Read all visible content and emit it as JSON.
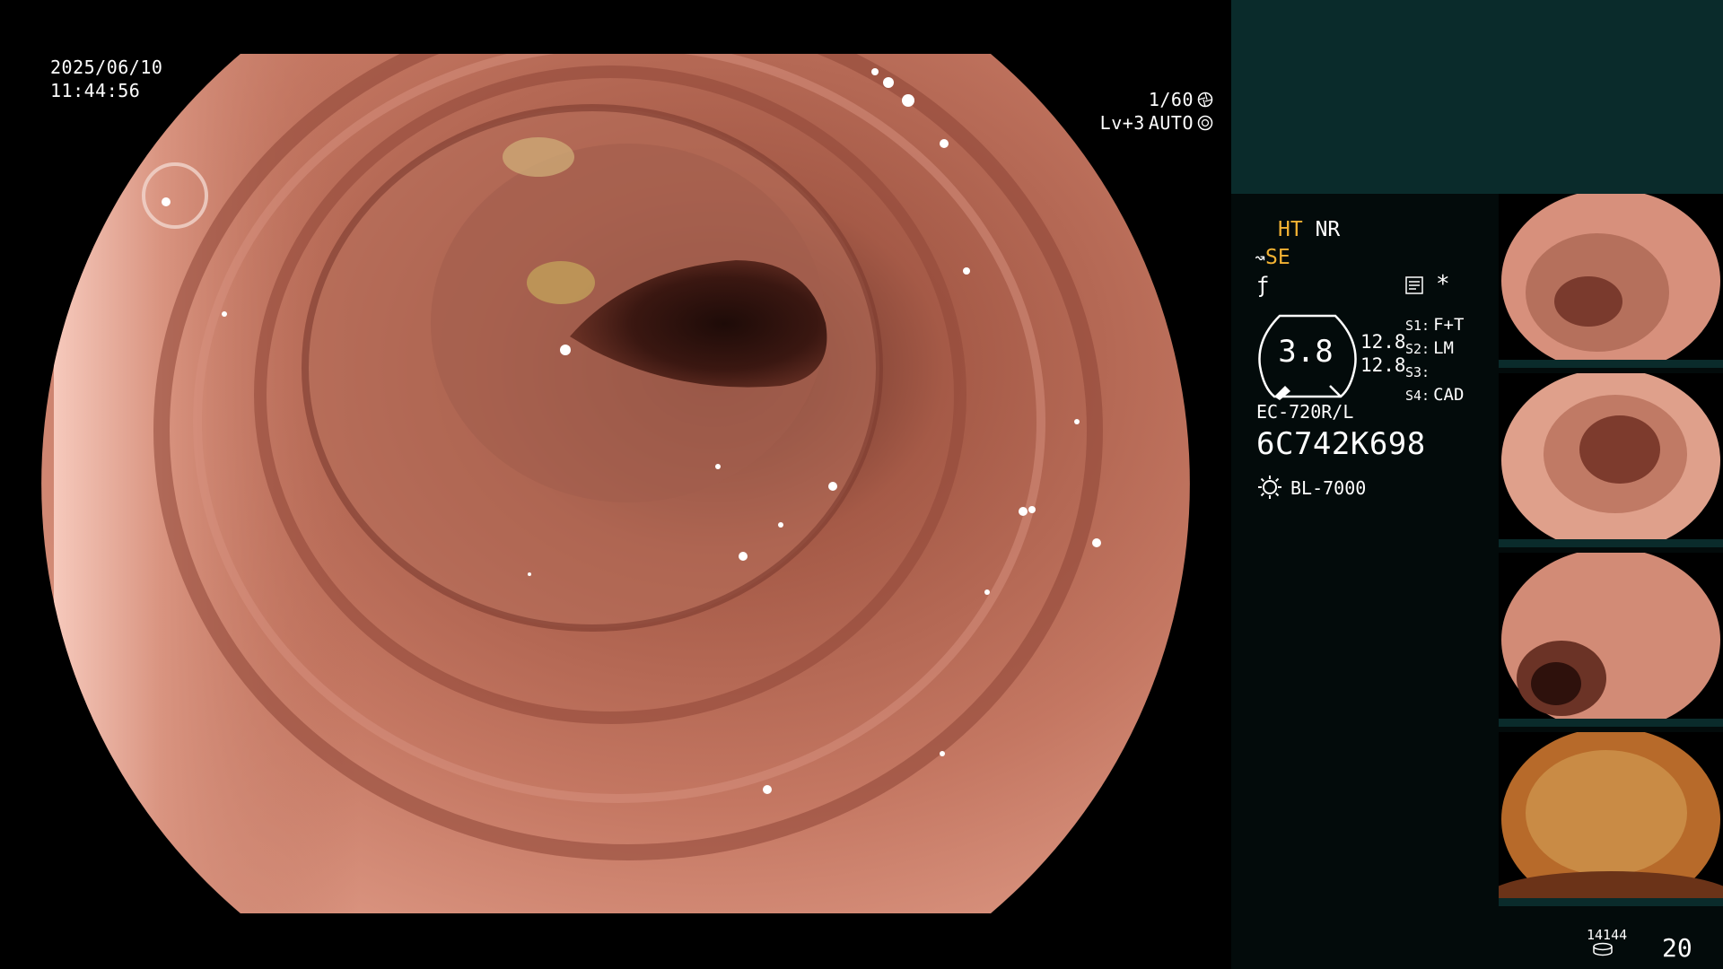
{
  "overlay": {
    "date": "2025/06/10",
    "time": "11:44:56",
    "shutter": "1/60",
    "shutter_icon": "aperture-icon",
    "brightness": "Lv+3",
    "iris_mode": "AUTO",
    "iris_icon": "iris-icon"
  },
  "panel": {
    "mode_ht": "HT",
    "mode_nr": "NR",
    "mode_se": "SE",
    "memo_icon": "memo-icon",
    "asterisk": "*",
    "gauge_value": "3.8",
    "scale_top": "12.8",
    "scale_bottom": "12.8",
    "settings": [
      {
        "label": "S1:",
        "value": "F+T"
      },
      {
        "label": "S2:",
        "value": "LM"
      },
      {
        "label": "S3:",
        "value": ""
      },
      {
        "label": "S4:",
        "value": "CAD"
      }
    ],
    "scope_model": "EC-720R/L",
    "scope_serial": "6C742K698",
    "light_source": "BL-7000",
    "record_count": "14144",
    "frame_count": "20"
  },
  "thumbnails": [
    {
      "label": "thumbnail-1"
    },
    {
      "label": "thumbnail-2"
    },
    {
      "label": "thumbnail-3"
    },
    {
      "label": "thumbnail-4"
    }
  ],
  "colors": {
    "background": "#000000",
    "panel_bg": "#030b0b",
    "panel_top": "#0a2b2b",
    "mode_yellow": "#f2b233",
    "tissue": "#b0604c"
  }
}
